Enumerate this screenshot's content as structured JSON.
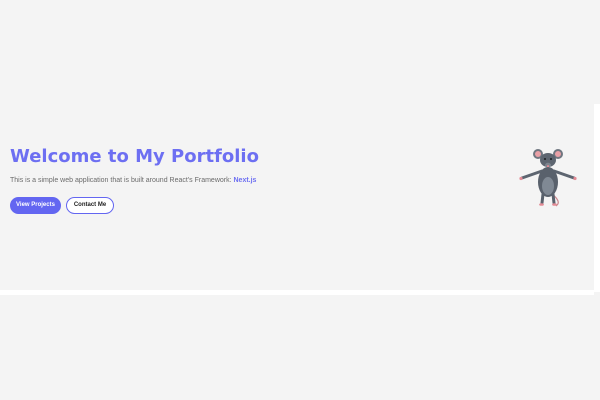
{
  "hero": {
    "title": "Welcome to My Portfolio",
    "subtitle_prefix": "This is a simple web application that is built around React's Framework: ",
    "subtitle_link": "Next.js",
    "primary_button": "View Projects",
    "secondary_button": "Contact Me",
    "mascot_icon": "rat-character-icon"
  },
  "colors": {
    "accent": "#6366f1",
    "background": "#f4f4f4",
    "text_muted": "#6b6b6b"
  }
}
